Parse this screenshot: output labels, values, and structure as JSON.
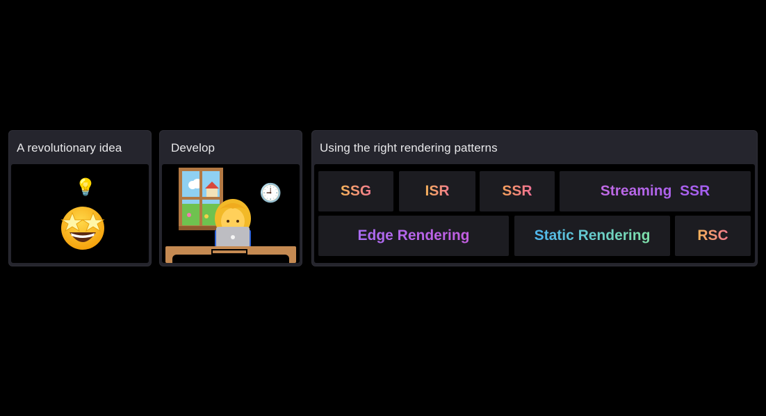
{
  "cards": [
    {
      "title": "A revolutionary idea"
    },
    {
      "title": "Develop"
    },
    {
      "title": "Using the right rendering patterns"
    }
  ],
  "patterns": {
    "ssg": "SSG",
    "isr": "ISR",
    "ssr": "SSR",
    "streaming_ssr": "Streaming  SSR",
    "edge": "Edge Rendering",
    "static": "Static Rendering",
    "rsc": "RSC"
  },
  "emoji": {
    "lightbulb": "💡",
    "star_struck": "🤩",
    "clock": "🕘",
    "developer": "👩‍💻"
  }
}
